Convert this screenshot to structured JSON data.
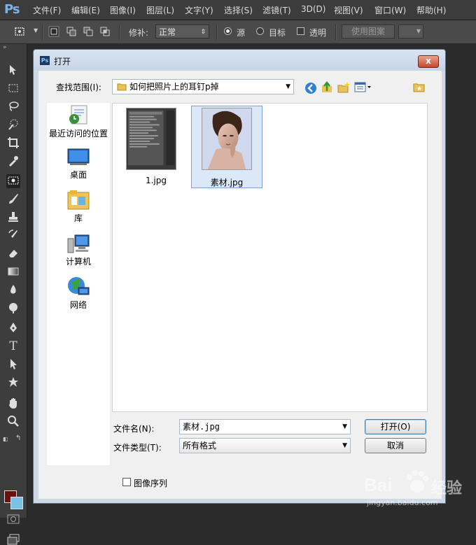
{
  "app": {
    "logo": "Ps",
    "menu": [
      "文件(F)",
      "编辑(E)",
      "图像(I)",
      "图层(L)",
      "文字(Y)",
      "选择(S)",
      "滤镜(T)",
      "3D(D)",
      "视图(V)",
      "窗口(W)",
      "帮助(H)"
    ]
  },
  "options_bar": {
    "patch_label": "修补:",
    "patch_mode": "正常",
    "source_label": "源",
    "target_label": "目标",
    "transparent_label": "透明",
    "use_pattern_label": "使用图案",
    "source_selected": true
  },
  "toolbox": {
    "tools": [
      "move-tool",
      "marquee-tool",
      "lasso-tool",
      "quick-select-tool",
      "crop-tool",
      "eyedropper-tool",
      "patch-tool",
      "brush-tool",
      "stamp-tool",
      "history-brush-tool",
      "eraser-tool",
      "gradient-tool",
      "blur-tool",
      "dodge-tool",
      "pen-tool",
      "type-tool",
      "path-select-tool",
      "shape-tool",
      "hand-tool",
      "zoom-tool"
    ],
    "type_glyph": "T",
    "selected_tool": "patch-tool",
    "foreground_color": "#6b0f0f",
    "background_color": "#7dc0e6"
  },
  "dialog": {
    "title": "打开",
    "close_label": "x",
    "look_in_label": "查找范围(I):",
    "current_folder": "如何把照片上的耳钉p掉",
    "places": [
      {
        "label": "最近访问的位置",
        "icon": "recent-places-icon"
      },
      {
        "label": "桌面",
        "icon": "desktop-icon"
      },
      {
        "label": "库",
        "icon": "libraries-icon"
      },
      {
        "label": "计算机",
        "icon": "computer-icon"
      },
      {
        "label": "网络",
        "icon": "network-icon"
      }
    ],
    "files": [
      {
        "name": "1.jpg",
        "selected": false
      },
      {
        "name": "素材.jpg",
        "selected": true
      }
    ],
    "filename_label": "文件名(N):",
    "filename_value": "素材.jpg",
    "filetype_label": "文件类型(T):",
    "filetype_value": "所有格式",
    "open_button": "打开(O)",
    "cancel_button": "取消",
    "image_sequence_label": "图像序列"
  },
  "watermark": {
    "brand": "Bai",
    "brand_tail": "经验",
    "url": "jingyan.baidu.com"
  }
}
